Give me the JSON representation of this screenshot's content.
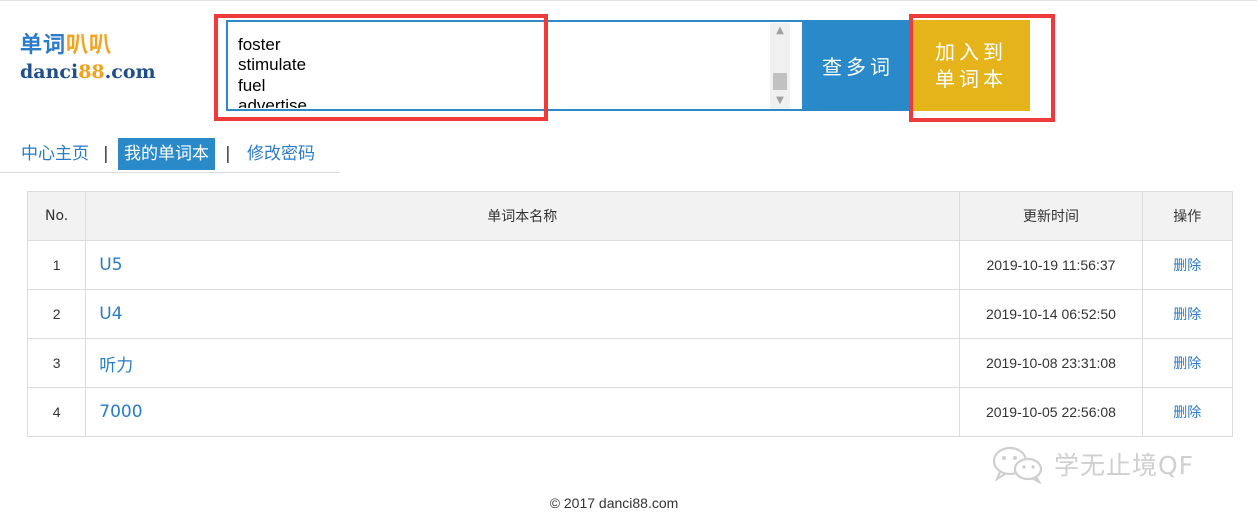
{
  "logo": {
    "cn_part1": "单词",
    "cn_part2": "叭叭",
    "en_part1": "danci",
    "en_part2": "88",
    "en_part3": ".com"
  },
  "word_input": {
    "lines": [
      "foster",
      "stimulate",
      "fuel",
      "advertise"
    ]
  },
  "buttons": {
    "lookup": "查多词",
    "add_line1": "加入到",
    "add_line2": "单词本"
  },
  "nav": {
    "home": "中心主页",
    "my_books": "我的单词本",
    "change_password": "修改密码",
    "separator": "|"
  },
  "table": {
    "headers": {
      "no": "No.",
      "name": "单词本名称",
      "updated": "更新时间",
      "action": "操作"
    },
    "rows": [
      {
        "no": "1",
        "name": "U5",
        "updated": "2019-10-19 11:56:37",
        "action": "删除"
      },
      {
        "no": "2",
        "name": "U4",
        "updated": "2019-10-14 06:52:50",
        "action": "删除"
      },
      {
        "no": "3",
        "name": "听力",
        "updated": "2019-10-08 23:31:08",
        "action": "删除"
      },
      {
        "no": "4",
        "name": "7000",
        "updated": "2019-10-05 22:56:08",
        "action": "删除"
      }
    ]
  },
  "watermark": {
    "text": "学无止境QF",
    "icon": "wechat-icon"
  },
  "footer": {
    "text": "© 2017 danci88.com"
  },
  "colors": {
    "primary_blue": "#2a89c9",
    "add_button": "#e5b31a",
    "annotation_red": "#ef3a3a",
    "logo_orange": "#f5a11a"
  }
}
